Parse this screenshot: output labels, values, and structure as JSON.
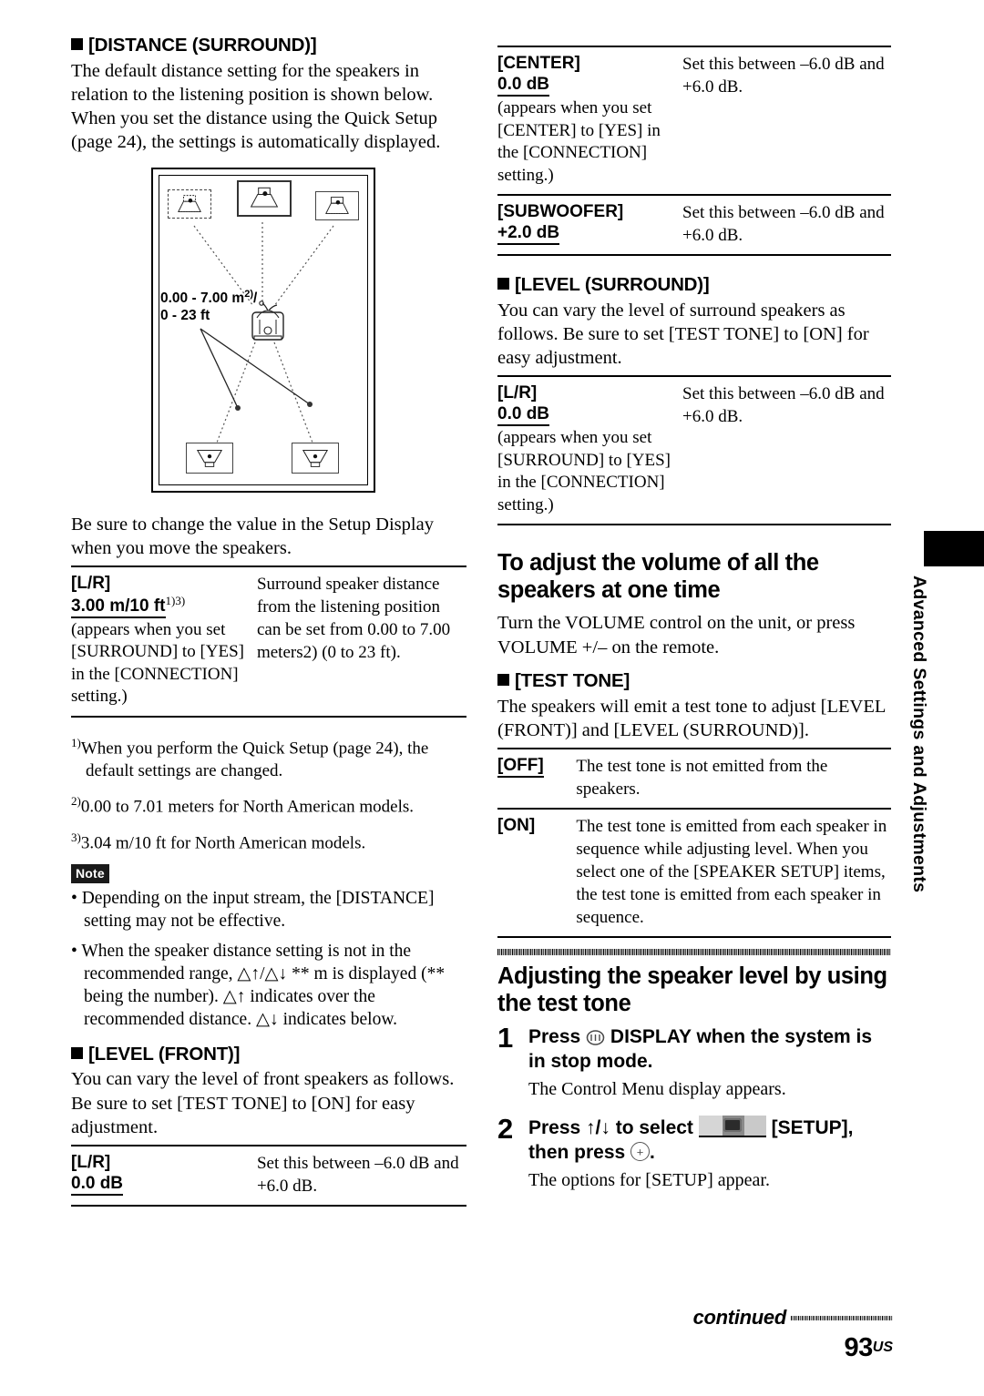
{
  "page": {
    "number": "93",
    "region_suffix": "US",
    "continued_label": "continued",
    "side_tab": "Advanced Settings and Adjustments"
  },
  "left_column": {
    "distance_surround": {
      "heading": "[DISTANCE (SURROUND)]",
      "paragraph": "The default distance setting for the speakers in relation to the listening position is shown below. When you set the distance using the Quick Setup (page 24), the settings is automatically displayed."
    },
    "diagram": {
      "name": "speaker-placement-diagram",
      "dim_line1": "0.00 - 7.00 m",
      "dim_line1_sup": "2)",
      "dim_line1_tail": "/",
      "dim_line2": "0 - 23 ft",
      "speakers": [
        {
          "id": "front-left",
          "type": "front"
        },
        {
          "id": "center",
          "type": "center"
        },
        {
          "id": "front-right",
          "type": "front"
        },
        {
          "id": "surround-left",
          "type": "surround"
        },
        {
          "id": "surround-right",
          "type": "surround"
        }
      ],
      "listener": "listening-position"
    },
    "after_diagram_paragraph": "Be sure to change the value in the Setup Display when you move the speakers.",
    "distance_table": [
      {
        "key_name": "[L/R]",
        "key_value": "3.00 m/10 ft",
        "key_value_sup": "1)3)",
        "key_note": "(appears when you set [SURROUND] to [YES] in the [CONNECTION] setting.)",
        "value": "Surround speaker distance from the listening position can be set from 0.00 to 7.00 meters2) (0 to 23 ft)."
      }
    ],
    "footnotes": [
      {
        "marker": "1)",
        "text": "When you perform the Quick Setup (page 24), the default settings are changed."
      },
      {
        "marker": "2)",
        "text": "0.00 to 7.01 meters for North American models."
      },
      {
        "marker": "3)",
        "text": "3.04 m/10 ft for North American models."
      }
    ],
    "note": {
      "badge": "Note",
      "bullets": [
        "Depending on the input stream, the [DISTANCE] setting may not be effective.",
        "When the speaker distance setting is not in the recommended range, △↑/△↓ ** m is displayed (** being the number). △↑ indicates over the recommended distance. △↓ indicates below."
      ]
    },
    "level_front": {
      "heading": "[LEVEL (FRONT)]",
      "paragraph": "You can vary the level of front speakers as follows. Be sure to set [TEST TONE] to [ON] for easy adjustment.",
      "table": [
        {
          "key_name": "[L/R]",
          "key_value": "0.0 dB",
          "key_note": "",
          "value": "Set this between –6.0 dB and +6.0 dB."
        }
      ]
    }
  },
  "right_column": {
    "level_front_continued_table": [
      {
        "key_name": "[CENTER]",
        "key_value": "0.0 dB",
        "key_note": "(appears when you set [CENTER] to [YES] in the [CONNECTION] setting.)",
        "value": "Set this between –6.0 dB and +6.0 dB."
      },
      {
        "key_name": "[SUBWOOFER]",
        "key_value": "+2.0 dB",
        "key_note": "",
        "value": "Set this between –6.0 dB and +6.0 dB."
      }
    ],
    "level_surround": {
      "heading": "[LEVEL (SURROUND)]",
      "paragraph": "You can vary the level of surround speakers as follows. Be sure to set [TEST TONE] to [ON] for easy adjustment.",
      "table": [
        {
          "key_name": "[L/R]",
          "key_value": "0.0 dB",
          "key_note": "(appears when you set [SURROUND] to [YES] in the [CONNECTION] setting.)",
          "value": "Set this between –6.0 dB and +6.0 dB."
        }
      ]
    },
    "volume_section": {
      "heading": "To adjust the volume of all the speakers at one time",
      "paragraph": "Turn the VOLUME control on the unit, or press VOLUME +/– on the remote."
    },
    "test_tone": {
      "heading": "[TEST TONE]",
      "paragraph": "The speakers will emit a test tone to adjust [LEVEL (FRONT)] and [LEVEL (SURROUND)].",
      "table": [
        {
          "key_name": "[OFF]",
          "underlined": true,
          "value": "The test tone is not emitted from the speakers."
        },
        {
          "key_name": "[ON]",
          "underlined": false,
          "value": "The test tone is emitted from each speaker in sequence while adjusting level. When you select one of the [SPEAKER SETUP] items, the test tone is emitted from each speaker in sequence."
        }
      ]
    },
    "adjusting_section": {
      "heading": "Adjusting the speaker level by using the test tone",
      "steps": [
        {
          "number": "1",
          "title_before": "Press",
          "icon": "display-icon",
          "title_after": "DISPLAY when the system is in stop mode.",
          "description": "The Control Menu display appears."
        },
        {
          "number": "2",
          "title_before": "Press ↑/↓ to select",
          "icon": "setup-thumbnail-icon",
          "title_after": "[SETUP], then press",
          "icon2": "enter-icon",
          "title_tail": ".",
          "description": "The options for [SETUP] appear."
        }
      ]
    }
  }
}
